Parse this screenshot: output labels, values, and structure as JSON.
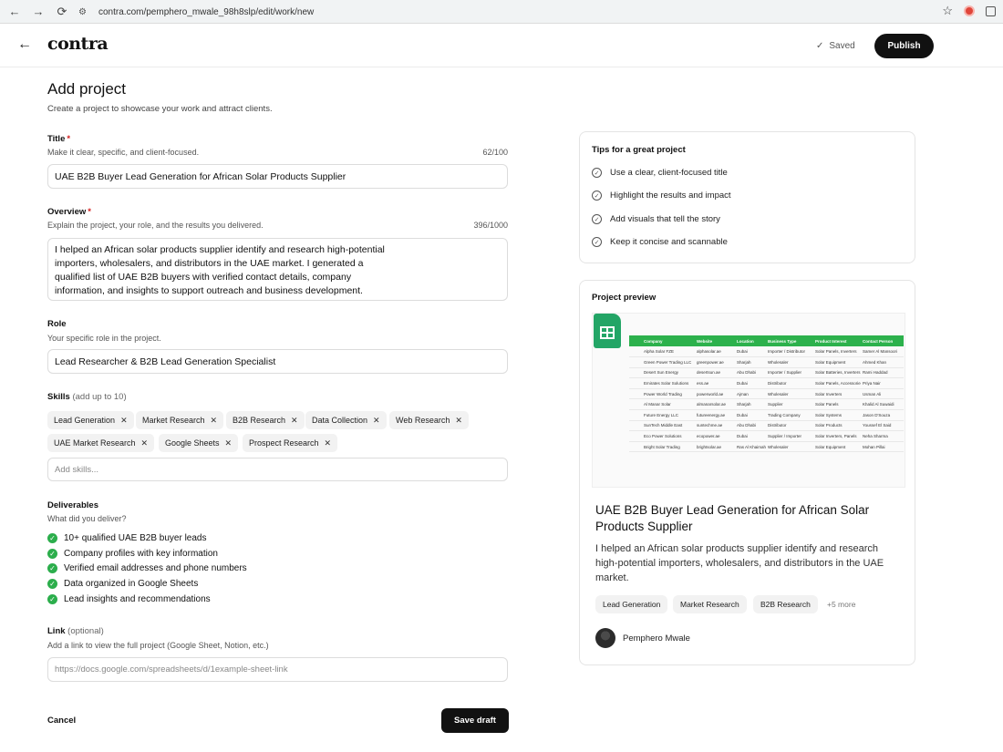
{
  "browser": {
    "url": "contra.com/pemphero_mwale_98h8slp/edit/work/new"
  },
  "header": {
    "logo": "contra",
    "saved_status": "Saved",
    "publish_label": "Publish"
  },
  "form": {
    "title": "Add project",
    "subtitle": "Create a project to showcase your work and attract clients.",
    "title_field": {
      "label": "Title",
      "required_mark": "*",
      "help": "Make it clear, specific, and client-focused.",
      "count": "62/100",
      "value": "UAE B2B Buyer Lead Generation for African Solar Products Supplier"
    },
    "overview_field": {
      "label": "Overview",
      "required_mark": "*",
      "help": "Explain the project, your role, and the results you delivered.",
      "count": "396/1000",
      "value": "I helped an African solar products supplier identify and research high-potential\nimporters, wholesalers, and distributors in the UAE market. I generated a\nqualified list of UAE B2B buyers with verified contact details, company\ninformation, and insights to support outreach and business development."
    },
    "role_field": {
      "label": "Role",
      "help": "Your specific role in the project.",
      "value": "Lead Researcher & B2B Lead Generation Specialist"
    },
    "skills_field": {
      "label": "Skills",
      "label_note": "(add up to 10)",
      "chips": [
        "Lead Generation",
        "Market Research",
        "B2B Research",
        "Data Collection",
        "Web Research",
        "UAE Market Research",
        "Google Sheets",
        "Prospect Research"
      ],
      "remove_icon": "✕",
      "placeholder": "Add skills..."
    },
    "deliverables": {
      "label": "Deliverables",
      "help": "What did you deliver?",
      "items": [
        "10+ qualified UAE B2B buyer leads",
        "Company profiles with key information",
        "Verified email addresses and phone numbers",
        "Data organized in Google Sheets",
        "Lead insights and recommendations"
      ]
    },
    "link_field": {
      "label": "Link",
      "label_note": "(optional)",
      "help": "Add a link to view the full project (Google Sheet, Notion, etc.)",
      "placeholder": "https://docs.google.com/spreadsheets/d/1example-sheet-link"
    },
    "cancel_label": "Cancel",
    "save_draft_label": "Save draft"
  },
  "tips": {
    "title": "Tips for a great project",
    "items": [
      "Use a clear, client-focused title",
      "Highlight the results and impact",
      "Add visuals that tell the story",
      "Keep it concise and scannable"
    ]
  },
  "preview": {
    "title": "Project preview",
    "sheet_headers": [
      "Company",
      "Website",
      "Location",
      "Business Type",
      "Product Interest",
      "Contact Person"
    ],
    "sheet_rows": [
      [
        "Alpha Solar FZE",
        "alphasolar.ae",
        "Dubai",
        "Importer / Distributor",
        "Solar Panels, Inverters",
        "Samer Al Mansoori"
      ],
      [
        "Green Power Trading LLC",
        "greenpower.ae",
        "Sharjah",
        "Wholesaler",
        "Solar Equipment",
        "Ahmed Khan"
      ],
      [
        "Desert Sun Energy",
        "desertsun.ae",
        "Abu Dhabi",
        "Importer / Supplier",
        "Solar Batteries, Inverters",
        "Rami Haddad"
      ],
      [
        "Emirates Solar Solutions",
        "ess.ae",
        "Dubai",
        "Distributor",
        "Solar Panels, Accessories",
        "Priya Nair"
      ],
      [
        "Power World Trading",
        "powerworld.ae",
        "Ajman",
        "Wholesaler",
        "Solar Inverters",
        "Usman Ali"
      ],
      [
        "Al Manar Solar",
        "almanarsolar.ae",
        "Sharjah",
        "Supplier",
        "Solar Panels",
        "Khalid Al Suwaidi"
      ],
      [
        "Future Energy LLC",
        "futureenergy.ae",
        "Dubai",
        "Trading Company",
        "Solar Systems",
        "Jason D'Souza"
      ],
      [
        "SunTech Middle East",
        "suntechme.ae",
        "Abu Dhabi",
        "Distributor",
        "Solar Products",
        "Youssef El Said"
      ],
      [
        "Eco Power Solutions",
        "ecopower.ae",
        "Dubai",
        "Supplier / Importer",
        "Solar Inverters, Panels",
        "Neha Sharma"
      ],
      [
        "Bright Solar Trading",
        "brightsolar.ae",
        "Ras Al Khaimah",
        "Wholesaler",
        "Solar Equipment",
        "Mohan Pillai"
      ]
    ],
    "project_title": "UAE B2B Buyer Lead Generation for African Solar Products Supplier",
    "project_desc": "I helped an African solar products supplier identify and research high-potential importers, wholesalers, and distributors in the UAE market.",
    "chips": [
      "Lead Generation",
      "Market Research",
      "B2B Research"
    ],
    "more": "+5 more",
    "author": "Pemphero Mwale"
  }
}
